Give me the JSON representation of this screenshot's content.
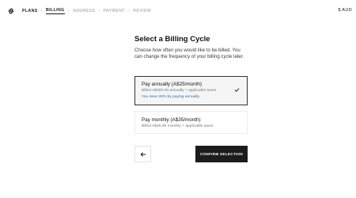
{
  "header": {
    "breadcrumbs": [
      {
        "label": "PLANS",
        "state": "done"
      },
      {
        "label": "BILLING",
        "state": "active"
      },
      {
        "label": "ADDRESS",
        "state": "pending"
      },
      {
        "label": "PAYMENT",
        "state": "pending"
      },
      {
        "label": "REVIEW",
        "state": "pending"
      }
    ],
    "currency": "$ AUD",
    "logo_icon": "squarespace-logo-icon",
    "separator_icon": "chevron-right-icon"
  },
  "main": {
    "title": "Select a Billing Cycle",
    "description": "Choose how often you would like to be billed. You can change the frequency of your billing cycle later."
  },
  "options": {
    "annual": {
      "title": "Pay annually (A$25/month)",
      "subtitle": "Billed A$300.00 annually + applicable taxes",
      "savings": "You save 28% by paying annually.",
      "selected": true
    },
    "monthly": {
      "title": "Pay monthly (A$35/month)",
      "subtitle": "Billed A$35.00 monthly + applicable taxes",
      "selected": false
    }
  },
  "actions": {
    "back_icon": "arrow-left-icon",
    "confirm_label": "CONFIRM SELECTION"
  },
  "colors": {
    "accent_link": "#2a6db5",
    "primary_button": "#1c1c1c"
  }
}
